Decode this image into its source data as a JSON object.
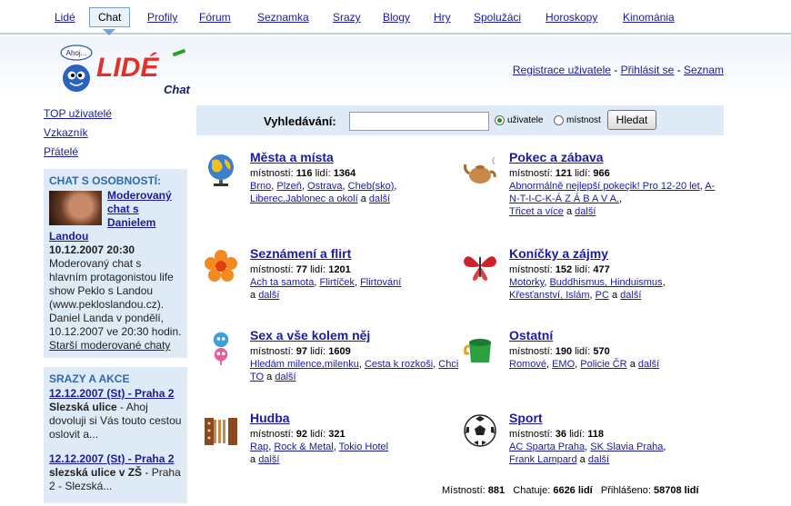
{
  "nav": {
    "items": [
      "Lidé",
      "Chat",
      "Profily",
      "Fórum",
      "Seznamka",
      "Srazy",
      "Blogy",
      "Hry",
      "Spolužáci",
      "Horoskopy",
      "Kinománia"
    ],
    "active": "Chat"
  },
  "logo": {
    "bubble": "Ahoj...",
    "brand": "LIDÉ",
    "sub": "Chat"
  },
  "header_links": {
    "register": "Registrace uživatele",
    "login": "Přihlásit se",
    "list": "Seznam",
    "sep": " - "
  },
  "sidebar": {
    "links": [
      "TOP uživatelé",
      "Vzkazník",
      "Přátelé"
    ],
    "chat_box": {
      "heading": "CHAT S OSOBNOSTÍ:",
      "title": "Moderovaný chat s Danielem Landou",
      "date": "10.12.2007 20:30",
      "text": "Moderovaný chat s hlavním protagonistou life show Peklo s Landou (www.pekloslandou.cz). Daniel Landa v pondělí, 10.12.2007 ve 20:30 hodin.",
      "older": "Starší moderované chaty"
    },
    "events_box": {
      "heading": "SRAZY A AKCE",
      "events": [
        {
          "date": "12.12.2007 (St) - Praha 2",
          "title": "Slezská ulice",
          "desc": " - Ahoj dovoluji si Vás touto cestou oslovit a..."
        },
        {
          "date": "12.12.2007 (St) - Praha 2",
          "title": "slezská ulice v ZŠ",
          "desc": " - Praha 2 - Slezská..."
        }
      ]
    }
  },
  "search": {
    "label": "Vyhledávání:",
    "value": "",
    "opt_users": "uživatele",
    "opt_rooms": "místnost",
    "button": "Hledat"
  },
  "categories": [
    {
      "title": "Města a místa",
      "rooms": "116",
      "people": "1364",
      "links": [
        "Brno",
        "Plzeň",
        "Ostrava",
        "Cheb(sko)",
        "Liberec,Jablonec a okolí"
      ],
      "more": "další",
      "icon": "globe-icon"
    },
    {
      "title": "Pokec a zábava",
      "rooms": "121",
      "people": "966",
      "links": [
        "Abnormálně nejlepší pokeçik! Pro 12-20 let",
        "A-N-T-I-C-K-Á Z Á B A V A.",
        "Třicet a více"
      ],
      "more": "další",
      "icon": "teapot-icon"
    },
    {
      "title": "Seznámení a flirt",
      "rooms": "77",
      "people": "1201",
      "links": [
        "Ach ta samota",
        "Flirtíček",
        "Flirtování"
      ],
      "more": "další",
      "icon": "flower-icon"
    },
    {
      "title": "Koníčky a zájmy",
      "rooms": "152",
      "people": "477",
      "links": [
        "Motorky",
        "Buddhismus, Hinduismus",
        "Křesťanství, Islám",
        "PC"
      ],
      "more": "další",
      "icon": "butterfly-icon"
    },
    {
      "title": "Sex a vše kolem něj",
      "rooms": "97",
      "people": "1609",
      "links": [
        "Hledám milence,milenku",
        "Cesta k rozkoši",
        "Chci TO"
      ],
      "more": "další",
      "icon": "gender-icon"
    },
    {
      "title": "Ostatní",
      "rooms": "190",
      "people": "570",
      "links": [
        "Romové",
        "EMO",
        "Policie ČR"
      ],
      "more": "další",
      "icon": "bucket-icon"
    },
    {
      "title": "Hudba",
      "rooms": "92",
      "people": "321",
      "links": [
        "Rap",
        "Rock & Metal",
        "Tokio Hotel"
      ],
      "more": "další",
      "icon": "accordion-icon"
    },
    {
      "title": "Sport",
      "rooms": "36",
      "people": "118",
      "links": [
        "AC Sparta Praha",
        "SK Slavia Praha",
        "Frank Lampard"
      ],
      "more": "další",
      "icon": "football-icon"
    }
  ],
  "labels": {
    "rooms": "místností:",
    "people": "lidí:",
    "and": "a"
  },
  "footer": {
    "rooms_label": "Místností:",
    "rooms": "881",
    "chatting_label": "Chatuje:",
    "chatting": "6626 lidí",
    "logged_label": "Přihlášeno:",
    "logged": "58708 lidí"
  },
  "colors": {
    "link": "#1a1aa6",
    "box_bg": "#dfeaf7",
    "box_heading": "#2d6ab0",
    "logo_red": "#e4302a",
    "logo_green": "#2f9e2f"
  }
}
